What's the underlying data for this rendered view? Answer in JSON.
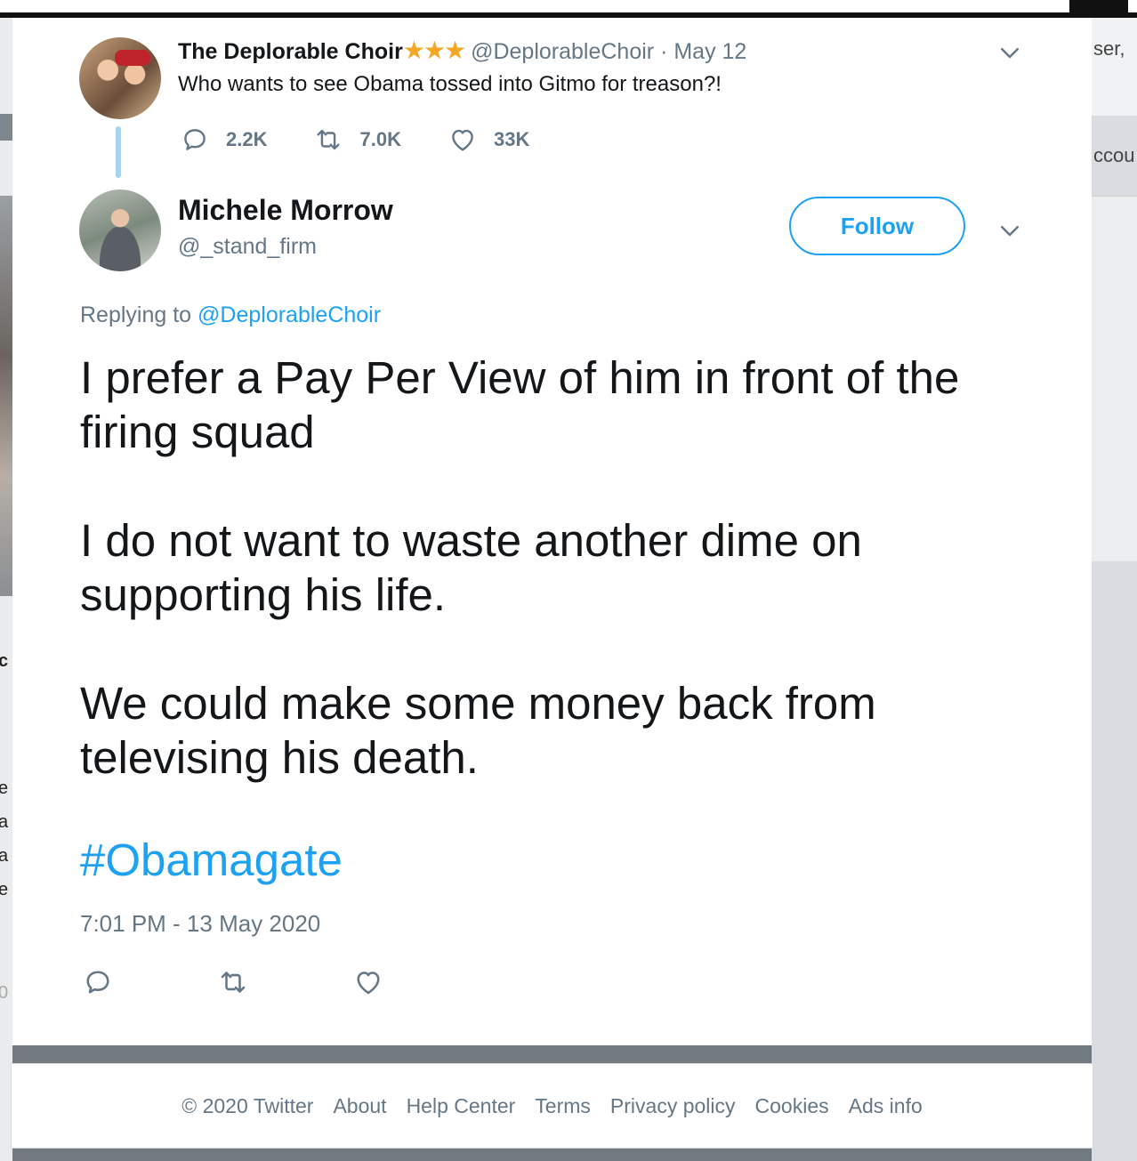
{
  "background": {
    "right_fragments": [
      "ser,",
      "ccou"
    ],
    "left_glyphs": [
      "c",
      "e",
      "a",
      "a",
      "e",
      "0"
    ]
  },
  "quoted_tweet": {
    "name": "The Deplorable Choir",
    "stars": "★★★",
    "handle": "@DeplorableChoir",
    "separator": "·",
    "date": "May 12",
    "text": "Who wants to see Obama tossed into Gitmo for treason?!",
    "replies": "2.2K",
    "retweets": "7.0K",
    "likes": "33K"
  },
  "tweet": {
    "name": "Michele Morrow",
    "handle": "@_stand_firm",
    "follow_label": "Follow",
    "replying_prefix": "Replying to",
    "replying_handle": "@DeplorableChoir",
    "paragraphs": [
      "I prefer a Pay Per View of him in front of the firing squad",
      "I do not want to waste another dime on supporting his life.",
      "We could make some money back from televising his death."
    ],
    "hashtag": "#Obamagate",
    "timestamp": "7:01 PM - 13 May 2020"
  },
  "footer": {
    "links": [
      "© 2020 Twitter",
      "About",
      "Help Center",
      "Terms",
      "Privacy policy",
      "Cookies",
      "Ads info"
    ]
  },
  "colors": {
    "accent": "#1da1f2",
    "muted": "#657786",
    "text": "#14171a",
    "star": "#f5a623",
    "thread_line": "#a3d4f0"
  }
}
